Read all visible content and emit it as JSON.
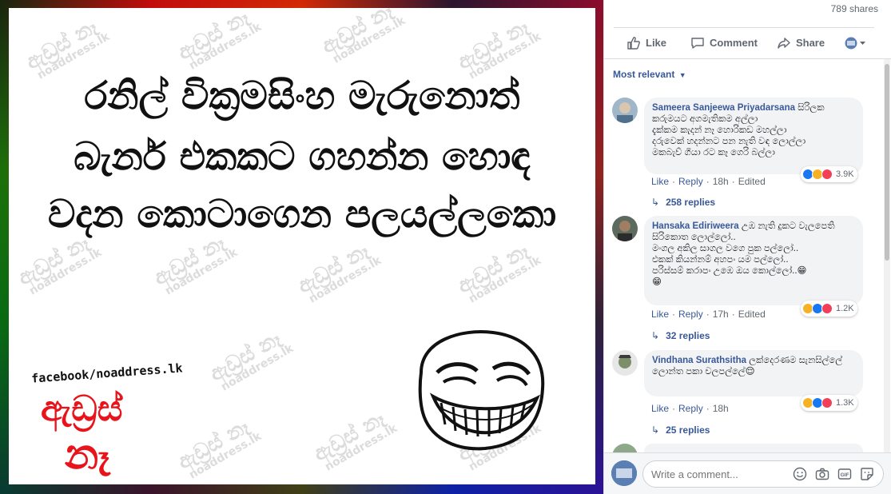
{
  "meme": {
    "lines": [
      "රනිල් වික්‍රමසිංහ මැරුනොත්",
      "බැනර් එකකට ගහන්න හොඳ",
      "වදන කොටාගෙන පලයල්ලකො"
    ],
    "watermark_main": "ඇඩ්‍රස් නෑ",
    "watermark_sub": "noaddress.lk",
    "facebook_handle": "facebook/noaddress.lk",
    "logo_line1": "ඇඩ්‍රස්",
    "logo_line2": "නෑ",
    "brand_red": "#e8141c"
  },
  "panel": {
    "shares": "789 shares",
    "actions": {
      "like": "Like",
      "comment": "Comment",
      "share": "Share"
    },
    "sort_label": "Most relevant",
    "comments": [
      {
        "author": "Sameera Sanjeewa Priyadarsana",
        "text": "සිරිලක කරුමයට අගමැතිකම අල්ලා\nදැක්කම කැදන් නෑ හොරිකඩ මහල්ලා\nදරුවෙක් හදන්නට පන නැති වඳ ලොල්ලා\nමකබැව් ගියා රට කෑ ගෙරි බල්ලා",
        "like": "Like",
        "reply": "Reply",
        "time": "18h",
        "edited": "Edited",
        "reaction_count": "3.9K",
        "replies": "258 replies"
      },
      {
        "author": "Hansaka Ediriweera",
        "text": "උඹ නැති දුකට වැලපෙති සිරිකොත ලොල්ලෝ..\nමංගල අකිල සාගල වගෙ පුක පල්ලෝ..\nඑකක් කියන්නම් අහපං යම පල්ලෝ..\nපරිස්සම් කරාපං උඹෙ ඔය කොල්ලෝ..😁\n😁",
        "like": "Like",
        "reply": "Reply",
        "time": "17h",
        "edited": "Edited",
        "reaction_count": "1.2K",
        "replies": "32 replies"
      },
      {
        "author": "Vindhana Surathsitha",
        "text": "ලක්දෙරණම සැනසිල්ලේ\nලොන්ත පකා චලපල්ලේ😌",
        "like": "Like",
        "reply": "Reply",
        "time": "18h",
        "reaction_count": "1.3K",
        "replies": "25 replies"
      }
    ],
    "composer_placeholder": "Write a comment..."
  }
}
